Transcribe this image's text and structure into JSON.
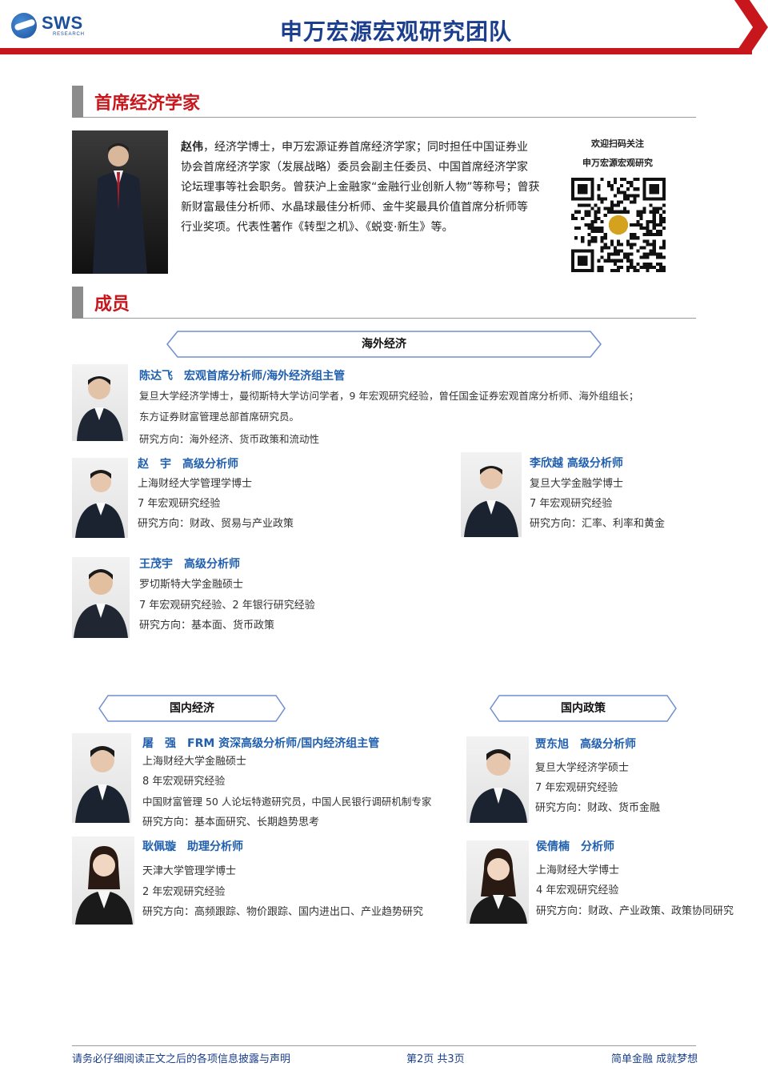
{
  "header": {
    "logo_text": "SWS",
    "logo_sub": "RESEARCH",
    "title": "申万宏源宏观研究团队",
    "accent": "#c8161d",
    "brand": "#1b3f8c"
  },
  "chief": {
    "section_title": "首席经济学家",
    "name": "赵伟",
    "bio_lines": [
      "，经济学博士，申万宏源证券首席经济学家；同时担任中国证券业",
      "协会首席经济学家（发展战略）委员会副主任委员、中国首席经济学家",
      "论坛理事等社会职务。曾获沪上金融家“金融行业创新人物”等称号；曾获",
      "新财富最佳分析师、水晶球最佳分析师、金牛奖最具价值首席分析师等",
      "行业奖项。代表性著作《转型之机》、《蜕变·新生》等。"
    ],
    "qr_caption_1": "欢迎扫码关注",
    "qr_caption_2": "申万宏源宏观研究"
  },
  "members": {
    "section_title": "成员",
    "overseas": {
      "banner": "海外经济",
      "lead": {
        "name": "陈达飞　宏观首席分析师/海外经济组主管",
        "lines": [
          "复旦大学经济学博士，曼彻斯特大学访问学者，9 年宏观研究经验，曾任国金证券宏观首席分析师、海外组组长；",
          "东方证券财富管理总部首席研究员。",
          "研究方向：海外经济、货币政策和流动性"
        ]
      },
      "people": [
        {
          "name": "赵　宇　高级分析师",
          "lines": [
            "上海财经大学管理学博士",
            "7 年宏观研究经验",
            "研究方向：财政、贸易与产业政策"
          ]
        },
        {
          "name": "李欣越  高级分析师",
          "lines": [
            "复旦大学金融学博士",
            "7 年宏观研究经验",
            "研究方向：汇率、利率和黄金"
          ]
        },
        {
          "name": "王茂宇　高级分析师",
          "lines": [
            "罗切斯特大学金融硕士",
            "7 年宏观研究经验、2 年银行研究经验",
            "研究方向：基本面、货币政策"
          ]
        }
      ]
    },
    "domestic_economy": {
      "banner": "国内经济",
      "people": [
        {
          "name": "屠　强　FRM 资深高级分析师/国内经济组主管",
          "lines": [
            "上海财经大学金融硕士",
            "8 年宏观研究经验",
            "中国财富管理 50 人论坛特邀研究员，中国人民银行调研机制专家",
            "研究方向：基本面研究、长期趋势思考"
          ]
        },
        {
          "name": "耿佩璇　助理分析师",
          "lines": [
            "天津大学管理学博士",
            "2 年宏观研究经验",
            "研究方向：高频跟踪、物价跟踪、国内进出口、产业趋势研究"
          ]
        }
      ]
    },
    "domestic_policy": {
      "banner": "国内政策",
      "people": [
        {
          "name": "贾东旭　高级分析师",
          "lines": [
            "复旦大学经济学硕士",
            "7 年宏观研究经验",
            "研究方向：财政、货币金融"
          ]
        },
        {
          "name": "侯倩楠　分析师",
          "lines": [
            "上海财经大学博士",
            "4 年宏观研究经验",
            "研究方向：财政、产业政策、政策协同研究"
          ]
        }
      ]
    }
  },
  "footer": {
    "disclaimer": "请务必仔细阅读正文之后的各项信息披露与声明",
    "page": "第2页  共3页",
    "slogan": "简单金融 成就梦想"
  }
}
